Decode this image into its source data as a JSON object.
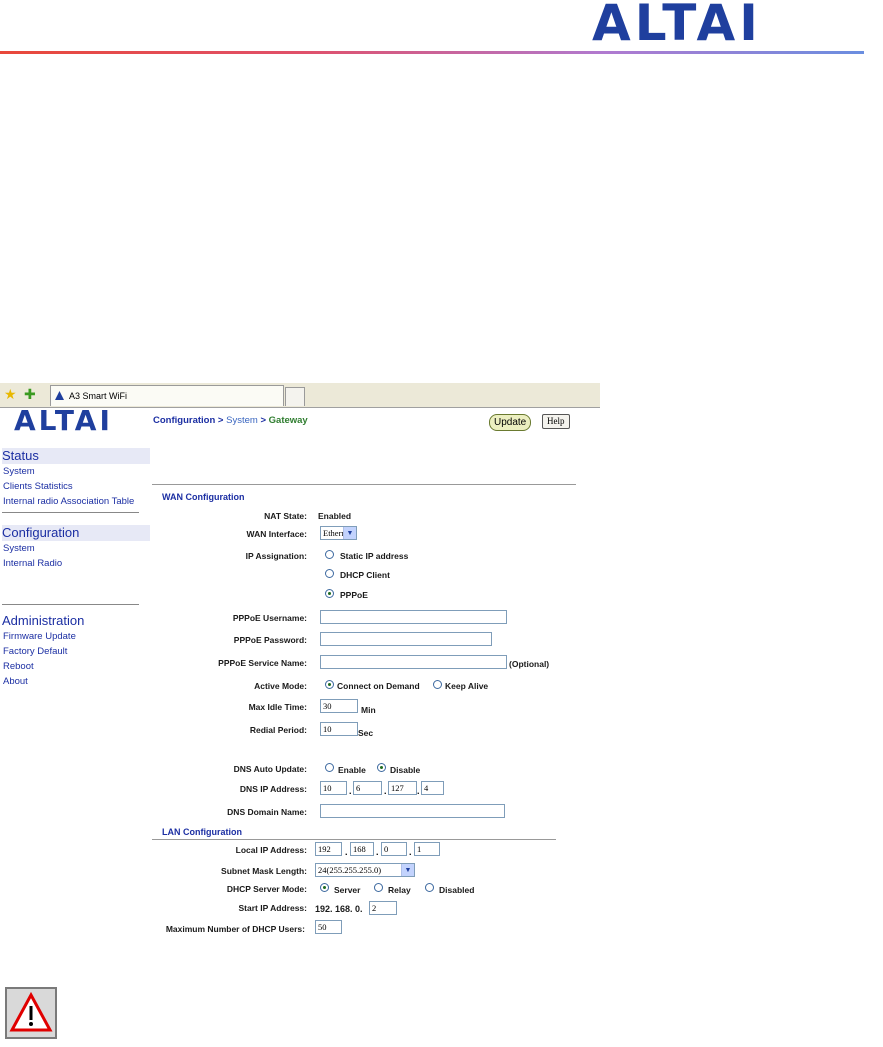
{
  "page": {
    "logo": "ALTAI",
    "warning_icon": "warning-triangle-icon"
  },
  "browser": {
    "star_icon": "favorites-star-icon",
    "add_icon": "add-favorite-icon",
    "tab_title": "A3 Smart WiFi"
  },
  "sidebar": {
    "logo": "ALTAI",
    "status": {
      "title": "Status",
      "items": [
        "System",
        "Clients Statistics",
        "Internal radio Association Table"
      ]
    },
    "configuration": {
      "title": "Configuration",
      "items": [
        "System",
        "Internal Radio"
      ]
    },
    "administration": {
      "title": "Administration",
      "items": [
        "Firmware Update",
        "Factory Default",
        "Reboot",
        "About"
      ]
    }
  },
  "header": {
    "crumb1": "Configuration",
    "crumb2": "System",
    "crumb3": "Gateway",
    "sep": ">",
    "update_label": "Update",
    "help_label": "Help"
  },
  "wan": {
    "title": "WAN Configuration",
    "nat_label": "NAT State:",
    "nat_value": "Enabled",
    "wan_interface_label": "WAN Interface:",
    "wan_interface_value": "Ethernet",
    "ip_assign_label": "IP Assignation:",
    "ip_options": [
      "Static IP address",
      "DHCP Client",
      "PPPoE"
    ],
    "ip_selected": "PPPoE",
    "pppoe_user_label": "PPPoE Username:",
    "pppoe_user_value": "",
    "pppoe_pass_label": "PPPoE Password:",
    "pppoe_pass_value": "",
    "pppoe_service_label": "PPPoE Service Name:",
    "pppoe_service_value": "",
    "optional": "(Optional)",
    "active_mode_label": "Active Mode:",
    "active_mode_options": [
      "Connect on Demand",
      "Keep Alive"
    ],
    "active_mode_selected": "Connect on Demand",
    "max_idle_label": "Max Idle Time:",
    "max_idle_value": "30",
    "max_idle_unit": "Min",
    "redial_label": "Redial Period:",
    "redial_value": "10",
    "redial_unit": "Sec",
    "dns_auto_label": "DNS Auto Update:",
    "dns_auto_options": [
      "Enable",
      "Disable"
    ],
    "dns_auto_selected": "Disable",
    "dns_ip_label": "DNS IP Address:",
    "dns_ip": [
      "10",
      "6",
      "127",
      "4"
    ],
    "dns_domain_label": "DNS Domain Name:",
    "dns_domain_value": ""
  },
  "lan": {
    "title": "LAN Configuration",
    "local_ip_label": "Local IP Address:",
    "local_ip": [
      "192",
      "168",
      "0",
      "1"
    ],
    "subnet_label": "Subnet Mask Length:",
    "subnet_value": "24(255.255.255.0)",
    "dhcp_mode_label": "DHCP Server Mode:",
    "dhcp_mode_options": [
      "Server",
      "Relay",
      "Disabled"
    ],
    "dhcp_mode_selected": "Server",
    "start_ip_label": "Start IP Address:",
    "start_ip_prefix": "192. 168. 0.",
    "start_ip_last": "2",
    "max_users_label": "Maximum Number of DHCP Users:",
    "max_users_value": "50"
  },
  "colors": {
    "brand_blue": "#1f3f9e",
    "link_blue": "#1c2fa3",
    "crumb_green": "#2f7d2f"
  }
}
